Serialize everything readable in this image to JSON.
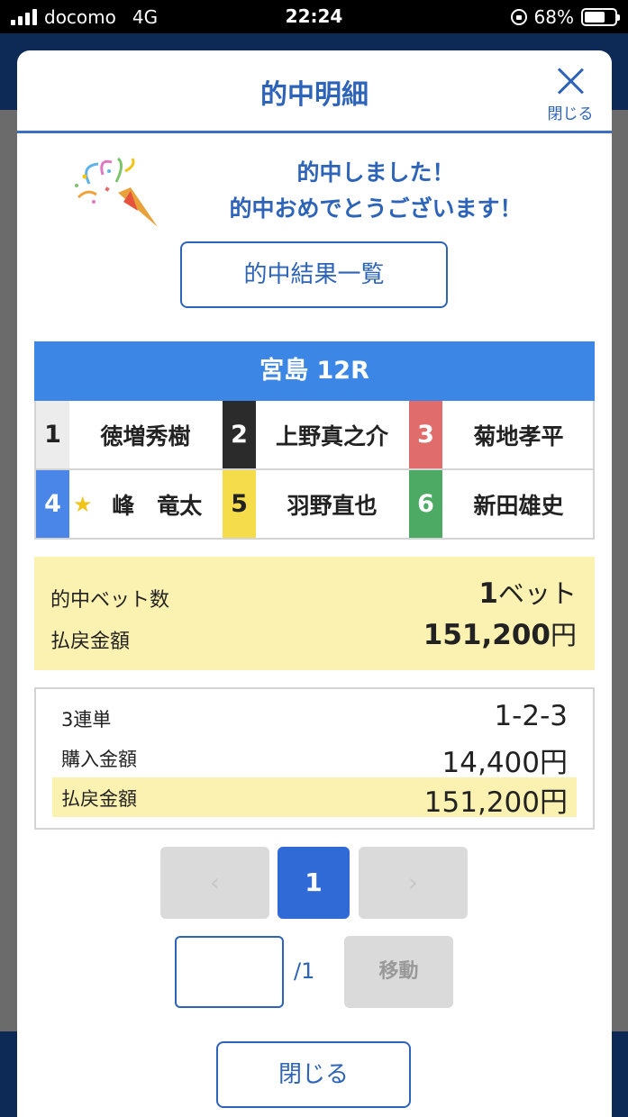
{
  "status_bar": {
    "carrier": "docomo",
    "network": "4G",
    "time": "22:24",
    "battery": "68%",
    "battery_level": 0.68
  },
  "modal": {
    "title": "的中明細",
    "close_label": "閉じる",
    "congrats_line1": "的中しました！",
    "congrats_line2": "的中おめでとうございます！",
    "result_list_button": "的中結果一覧"
  },
  "race": {
    "label": "宮島 12R",
    "racers": [
      {
        "number": "1",
        "name": "徳増秀樹",
        "color": "#ececec",
        "num_color": "#222222"
      },
      {
        "number": "2",
        "name": "上野真之介",
        "color": "#2b2b2b",
        "num_color": "#ffffff"
      },
      {
        "number": "3",
        "name": "菊地孝平",
        "color": "#e06c6c",
        "num_color": "#ffffff"
      },
      {
        "number": "4",
        "name": "峰　竜太",
        "color": "#4a86e8",
        "num_color": "#ffffff",
        "starred": true
      },
      {
        "number": "5",
        "name": "羽野直也",
        "color": "#f5dc4a",
        "num_color": "#222222"
      },
      {
        "number": "6",
        "name": "新田雄史",
        "color": "#4caa64",
        "num_color": "#ffffff"
      }
    ]
  },
  "summary": {
    "hit_bets_label": "的中ベット数",
    "hit_bets_num": "1",
    "hit_bets_unit": "ベット",
    "payout_label": "払戻金額",
    "payout_num": "151,200",
    "payout_unit": "円"
  },
  "detail": {
    "bet_type": "3連単",
    "combination": "1-2-3",
    "purchase_label": "購入金額",
    "purchase_amount": "14,400円",
    "payout_label": "払戻金額",
    "payout_amount": "151,200円"
  },
  "pager": {
    "prev_symbol": "‹",
    "current_page": "1",
    "next_symbol": "›",
    "input_value": "",
    "total": "/1",
    "move_label": "移動"
  },
  "footer": {
    "close_label": "閉じる"
  },
  "colors": {
    "accent": "#2d63b8",
    "race_bar": "#3c86e6",
    "highlight": "#fbf1b0",
    "current_page": "#2f6ad6"
  }
}
